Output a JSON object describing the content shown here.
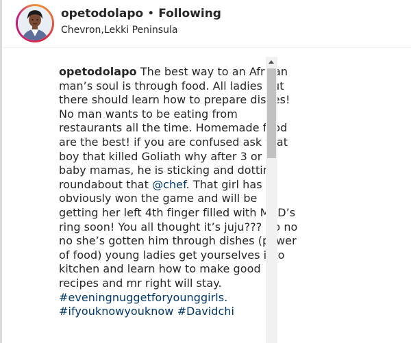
{
  "header": {
    "username": "opetodolapo",
    "separator": "•",
    "follow_status": "Following",
    "location": "Chevron,Lekki Peninsula",
    "avatar_icon": "profile-photo-avatar"
  },
  "caption": {
    "author": "opetodolapo",
    "lines": [
      "The best way to an African",
      "man’s soul is through food. All ladies out",
      "there should learn how to prepare dishes!",
      "No man wants to be eating from",
      "restaurants all the time. Homemade food",
      "are the best! if you are confused ask that",
      "boy that killed Goliath why after 3 or 4",
      "baby mamas, he is sticking and dotting",
      "roundabout that ",
      "obviously won the game and will be",
      "getting her left 4th finger filled with Mr D’s",
      "ring soon! You all thought it’s juju??? No no",
      "no she’s gotten him through dishes (power",
      "of food) young ladies get yourselves into",
      "kitchen and learn how to make good",
      "recipes and mr right will stay."
    ],
    "mention": "@chef",
    "mention_suffix": ". That girl has",
    "hashtag_1": "#eveningnuggetforyounggirls.",
    "hashtag_2": "#ifyouknowyouknow",
    "hashtag_3": "#Davidchi"
  },
  "colors": {
    "text": "#262626",
    "link": "#00376b",
    "scroll_track": "#f1f1f1",
    "scroll_thumb": "#c1c1c1"
  }
}
